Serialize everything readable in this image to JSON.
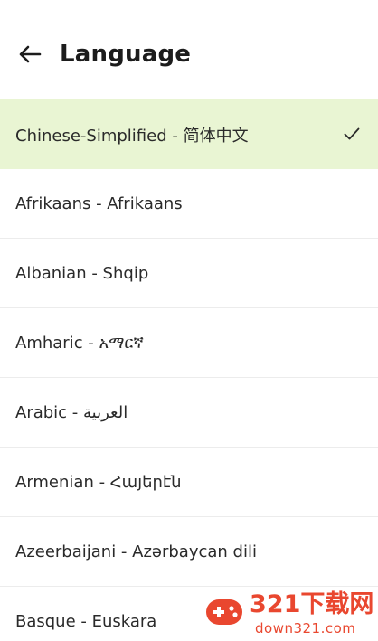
{
  "header": {
    "back_icon": "arrow-left-icon",
    "title": "Language"
  },
  "languages": [
    {
      "label": "Chinese-Simplified - 简体中文",
      "selected": true
    },
    {
      "label": "Afrikaans - Afrikaans",
      "selected": false
    },
    {
      "label": "Albanian - Shqip",
      "selected": false
    },
    {
      "label": "Amharic - አማርኛ",
      "selected": false
    },
    {
      "label": "Arabic - العربية",
      "selected": false
    },
    {
      "label": "Armenian - Հայերէն",
      "selected": false
    },
    {
      "label": "Azeerbaijani - Azərbaycan dili",
      "selected": false
    },
    {
      "label": "Basque - Euskara",
      "selected": false
    }
  ],
  "selected_icon": "check-icon",
  "colors": {
    "selected_background": "#e9f5d3",
    "text": "#2a2a2a",
    "watermark": "#e9472f"
  },
  "watermark": {
    "title": "321下载网",
    "subtitle": "down321.com"
  }
}
